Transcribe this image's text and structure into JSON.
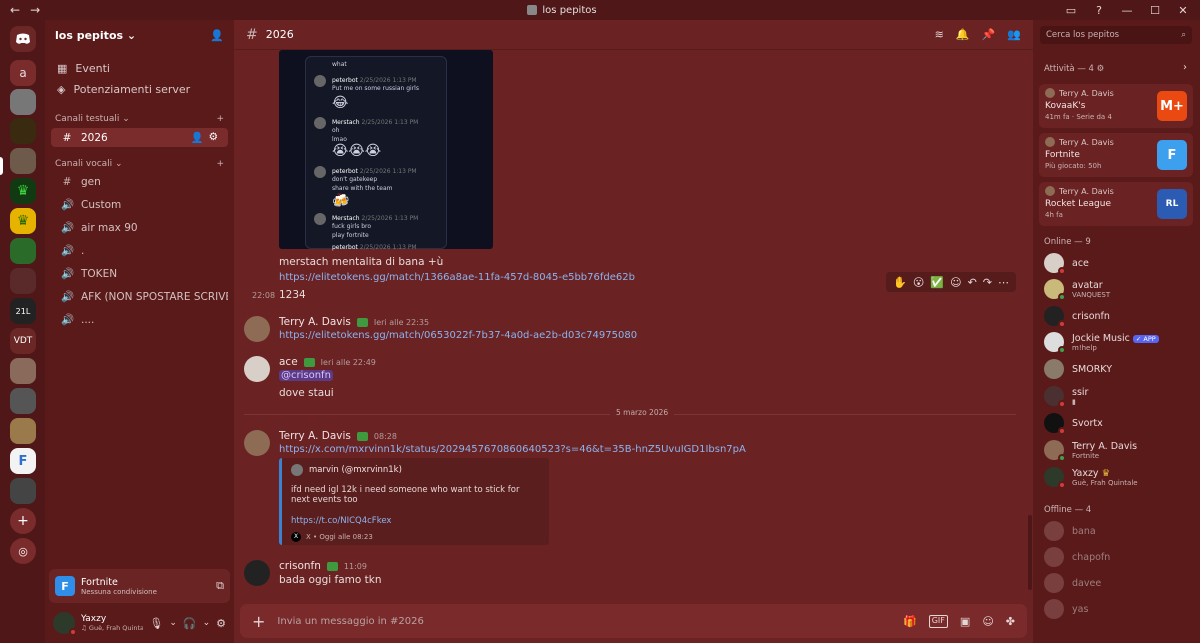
{
  "titlebar": {
    "title": "los pepitos"
  },
  "server": {
    "name": "los pepitos"
  },
  "sidebar": {
    "links": [
      {
        "label": "Eventi"
      },
      {
        "label": "Potenziamenti server"
      }
    ],
    "text_category": "Canali testuali",
    "voice_category": "Canali vocali",
    "text_channels": [
      {
        "label": "2026"
      }
    ],
    "voice_channels": [
      {
        "label": "gen"
      },
      {
        "label": "Custom"
      },
      {
        "label": "air max 90"
      },
      {
        "label": "."
      },
      {
        "label": "TOKEN"
      },
      {
        "label": "AFK (NON SPOSTARE SCRIVET..."
      },
      {
        "label": "...."
      }
    ]
  },
  "rail": {
    "home_letter": "a",
    "vdt": "VDT"
  },
  "activity_box": {
    "game": "Fortnite",
    "status": "Nessuna condivisione"
  },
  "user": {
    "name": "Yaxzy",
    "status": "Guè, Frah Quintale"
  },
  "channel_header": {
    "name": "2026"
  },
  "screenshot": {
    "lines": [
      {
        "name": "",
        "text": "what"
      },
      {
        "name": "peterbot",
        "time": "2/25/2026 1:13 PM",
        "text": "Put me on some russian girls"
      },
      {
        "name": "Merstach",
        "time": "2/25/2026 1:13 PM",
        "text": "oh"
      },
      {
        "name": "",
        "text": "lmao"
      },
      {
        "name": "peterbot",
        "time": "2/25/2026 1:13 PM",
        "text": "don't gatekeep"
      },
      {
        "name": "",
        "text": "share with the team"
      },
      {
        "name": "Merstach",
        "time": "2/25/2026 1:13 PM",
        "text": "fuck girls bro"
      },
      {
        "name": "",
        "text": "play fortnite"
      },
      {
        "name": "peterbot",
        "time": "2/25/2026 1:13 PM",
        "text": ""
      }
    ]
  },
  "messages": {
    "m1": {
      "text": "merstach mentalita di bana +ù",
      "link": "https://elitetokens.gg/match/1366a8ae-11fa-457d-8045-e5bb76fde62b"
    },
    "m2": {
      "time": "22:08",
      "text": "1234"
    },
    "m3": {
      "author": "Terry A. Davis",
      "time": "Ieri alle 22:35",
      "link": "https://elitetokens.gg/match/0653022f-7b37-4a0d-ae2b-d03c74975080"
    },
    "m4": {
      "author": "ace",
      "time": "Ieri alle 22:49",
      "mention": "@crisonfn",
      "text": "dove staui"
    },
    "divider": "5 marzo 2026",
    "m5": {
      "author": "Terry A. Davis",
      "time": "08:28",
      "link": "https://x.com/mxrvinn1k/status/2029457670860640523?s=46&t=35B-hnZ5UvuIGD1Ibsn7pA",
      "embed": {
        "author": "marvin (@mxrvinn1k)",
        "desc": "ifd need igl 12k i need someone who want to stick for next events too",
        "link": "https://t.co/NICQ4cFkex",
        "footer": "X • Oggi alle 08:23"
      }
    },
    "m6": {
      "author": "crisonfn",
      "time": "11:09",
      "text": "bada oggi famo tkn"
    }
  },
  "composer": {
    "placeholder": "Invia un messaggio in #2026"
  },
  "right_panel": {
    "search_placeholder": "Cerca los pepitos",
    "activity_title": "Attività — 4",
    "activities": [
      {
        "user": "Terry A. Davis",
        "game": "KovaaK's",
        "meta": "41m fa  ·  Serie da 4",
        "icon": "M+",
        "color": "#ea4a12"
      },
      {
        "user": "Terry A. Davis",
        "game": "Fortnite",
        "meta": "Più giocato: 50h",
        "icon": "F",
        "color": "#3da0ee"
      },
      {
        "user": "Terry A. Davis",
        "game": "Rocket League",
        "meta": "4h fa",
        "icon": "RL",
        "color": "#2c5bb3"
      }
    ],
    "online_title": "Online — 9",
    "online": [
      {
        "name": "ace",
        "status": ""
      },
      {
        "name": "avatar",
        "status": "VANQUEST"
      },
      {
        "name": "crisonfn",
        "status": ""
      },
      {
        "name": "Jockie Music",
        "status": "m!help",
        "app": "APP"
      },
      {
        "name": "SMORKY",
        "status": ""
      },
      {
        "name": "ssir",
        "status": ""
      },
      {
        "name": "Svortx",
        "status": ""
      },
      {
        "name": "Terry A. Davis",
        "status": "Fortnite"
      },
      {
        "name": "Yaxzy",
        "status": "Guè, Frah Quintale"
      }
    ],
    "offline_title": "Offline — 4",
    "offline": [
      {
        "name": "bana"
      },
      {
        "name": "chapofn"
      },
      {
        "name": "davee"
      },
      {
        "name": "yas"
      }
    ]
  }
}
